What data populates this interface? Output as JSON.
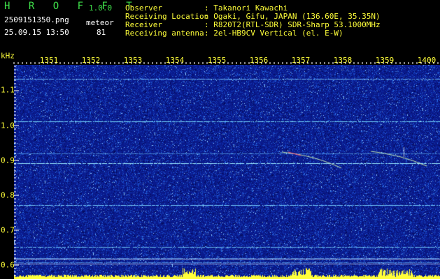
{
  "app": {
    "title_letters": "H R O F F T",
    "version": "1.0.0",
    "filename": "2509151350.png",
    "datetime": "25.09.15 13:50",
    "mode_label": "meteor",
    "count": "81"
  },
  "info": {
    "rows": [
      {
        "label": "Observer",
        "value": ": Takanori Kawachi"
      },
      {
        "label": "Receiving Location",
        "value": ": Ogaki, Gifu, JAPAN (136.60E, 35.35N)"
      },
      {
        "label": "Receiver",
        "value": ": R820T2(RTL-SDR) SDR-Sharp 53.1000MHz"
      },
      {
        "label": "Receiving antenna",
        "value": ": 2el-HB9CV Vertical (el. E-W)"
      }
    ]
  },
  "axes": {
    "freq_unit": "kHz",
    "time_ticks": [
      "1351",
      "1352",
      "1353",
      "1354",
      "1355",
      "1356",
      "1357",
      "1358",
      "1359",
      "1400"
    ],
    "freq_ticks": [
      "1.1",
      "1.0",
      "0.9",
      "0.8",
      "0.7",
      "0.6"
    ]
  },
  "colors": {
    "background": "#000000",
    "spectrogram_bg": "#0a1a8c",
    "text_green": "#3fe04a",
    "text_yellow": "#ffff3a",
    "text_white": "#ffffff"
  }
}
